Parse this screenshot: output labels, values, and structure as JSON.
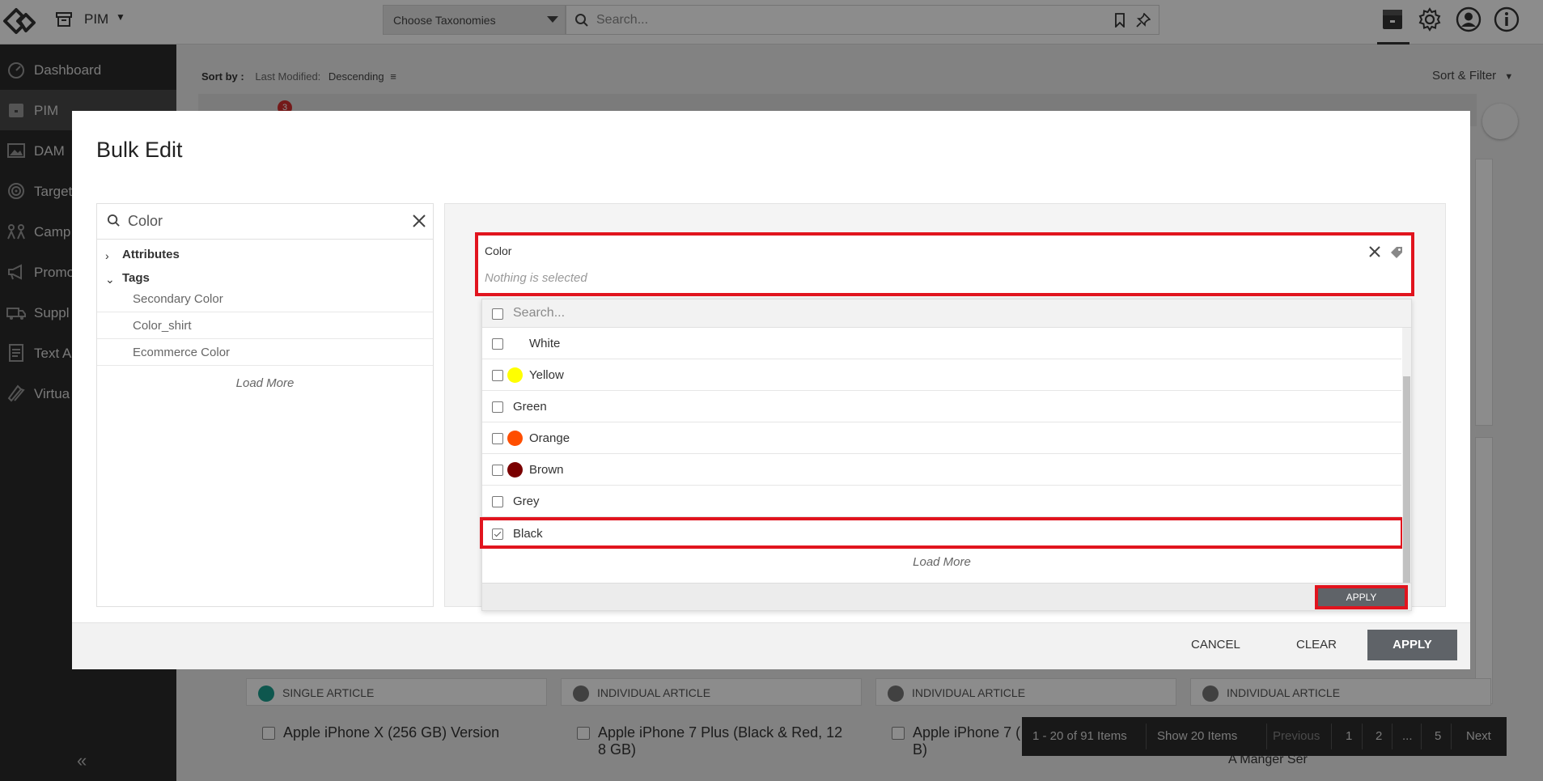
{
  "topbar": {
    "module_label": "PIM",
    "taxonomy_label": "Choose Taxonomies",
    "search_placeholder": "Search..."
  },
  "sidebar": {
    "items": [
      {
        "label": "Dashboard",
        "icon": "dashboard-icon"
      },
      {
        "label": "PIM",
        "icon": "pim-icon"
      },
      {
        "label": "DAM",
        "icon": "image-icon"
      },
      {
        "label": "Target",
        "icon": "target-icon"
      },
      {
        "label": "Camp",
        "icon": "campaign-icon"
      },
      {
        "label": "Promo",
        "icon": "megaphone-icon"
      },
      {
        "label": "Suppl",
        "icon": "truck-icon"
      },
      {
        "label": "Text A",
        "icon": "document-icon"
      },
      {
        "label": "Virtua",
        "icon": "virtual-icon"
      }
    ],
    "active_index": 1
  },
  "page": {
    "sort_label": "Sort by :",
    "sort_field": "Last Modified:",
    "sort_order": "Descending",
    "sort_filter": "Sort & Filter",
    "badge_count": "3",
    "cards": [
      {
        "type": "SINGLE ARTICLE",
        "title": "Apple iPhone X (256 GB) Version",
        "icon_color": "#1a9e8f"
      },
      {
        "type": "INDIVIDUAL ARTICLE",
        "title": "Apple iPhone 7 Plus (Black & Red, 12",
        "subtitle": "8 GB)",
        "icon_color": "#777777"
      },
      {
        "type": "INDIVIDUAL ARTICLE",
        "title": "Apple iPhone 7 (",
        "subtitle": "B)",
        "icon_color": "#777777"
      },
      {
        "type": "INDIVIDUAL ARTICLE",
        "title": "",
        "subtitle": "A Manger Ser",
        "icon_color": "#777777"
      }
    ],
    "pager": {
      "range": "1 - 20 of 91 Items",
      "show": "Show 20 Items",
      "previous": "Previous",
      "pages": [
        "1",
        "2",
        "...",
        "5"
      ],
      "next": "Next"
    }
  },
  "modal": {
    "title": "Bulk Edit",
    "left": {
      "search_value": "Color",
      "tree": [
        {
          "label": "Attributes",
          "expanded": false
        },
        {
          "label": "Tags",
          "expanded": true
        }
      ],
      "tag_children": [
        "Secondary Color",
        "Color_shirt",
        "Ecommerce Color"
      ],
      "load_more": "Load More"
    },
    "attribute": {
      "name": "Color",
      "value": "Nothing is selected"
    },
    "dropdown": {
      "search_placeholder": "Search...",
      "options": [
        {
          "label": "White",
          "swatch": "#ffffff",
          "checked": false
        },
        {
          "label": "Yellow",
          "swatch": "#ffff00",
          "checked": false
        },
        {
          "label": "Green",
          "swatch": "",
          "checked": false
        },
        {
          "label": "Orange",
          "swatch": "#ff4e00",
          "checked": false
        },
        {
          "label": "Brown",
          "swatch": "#7a0000",
          "checked": false
        },
        {
          "label": "Grey",
          "swatch": "",
          "checked": false
        },
        {
          "label": "Black",
          "swatch": "",
          "checked": true
        }
      ],
      "load_more": "Load More",
      "apply": "APPLY"
    },
    "footer": {
      "cancel": "CANCEL",
      "clear": "CLEAR",
      "apply": "APPLY"
    }
  },
  "colors": {
    "highlight": "#e1141e",
    "sidebar_bg": "#2a2a2a",
    "button_bg": "#5f6368"
  }
}
